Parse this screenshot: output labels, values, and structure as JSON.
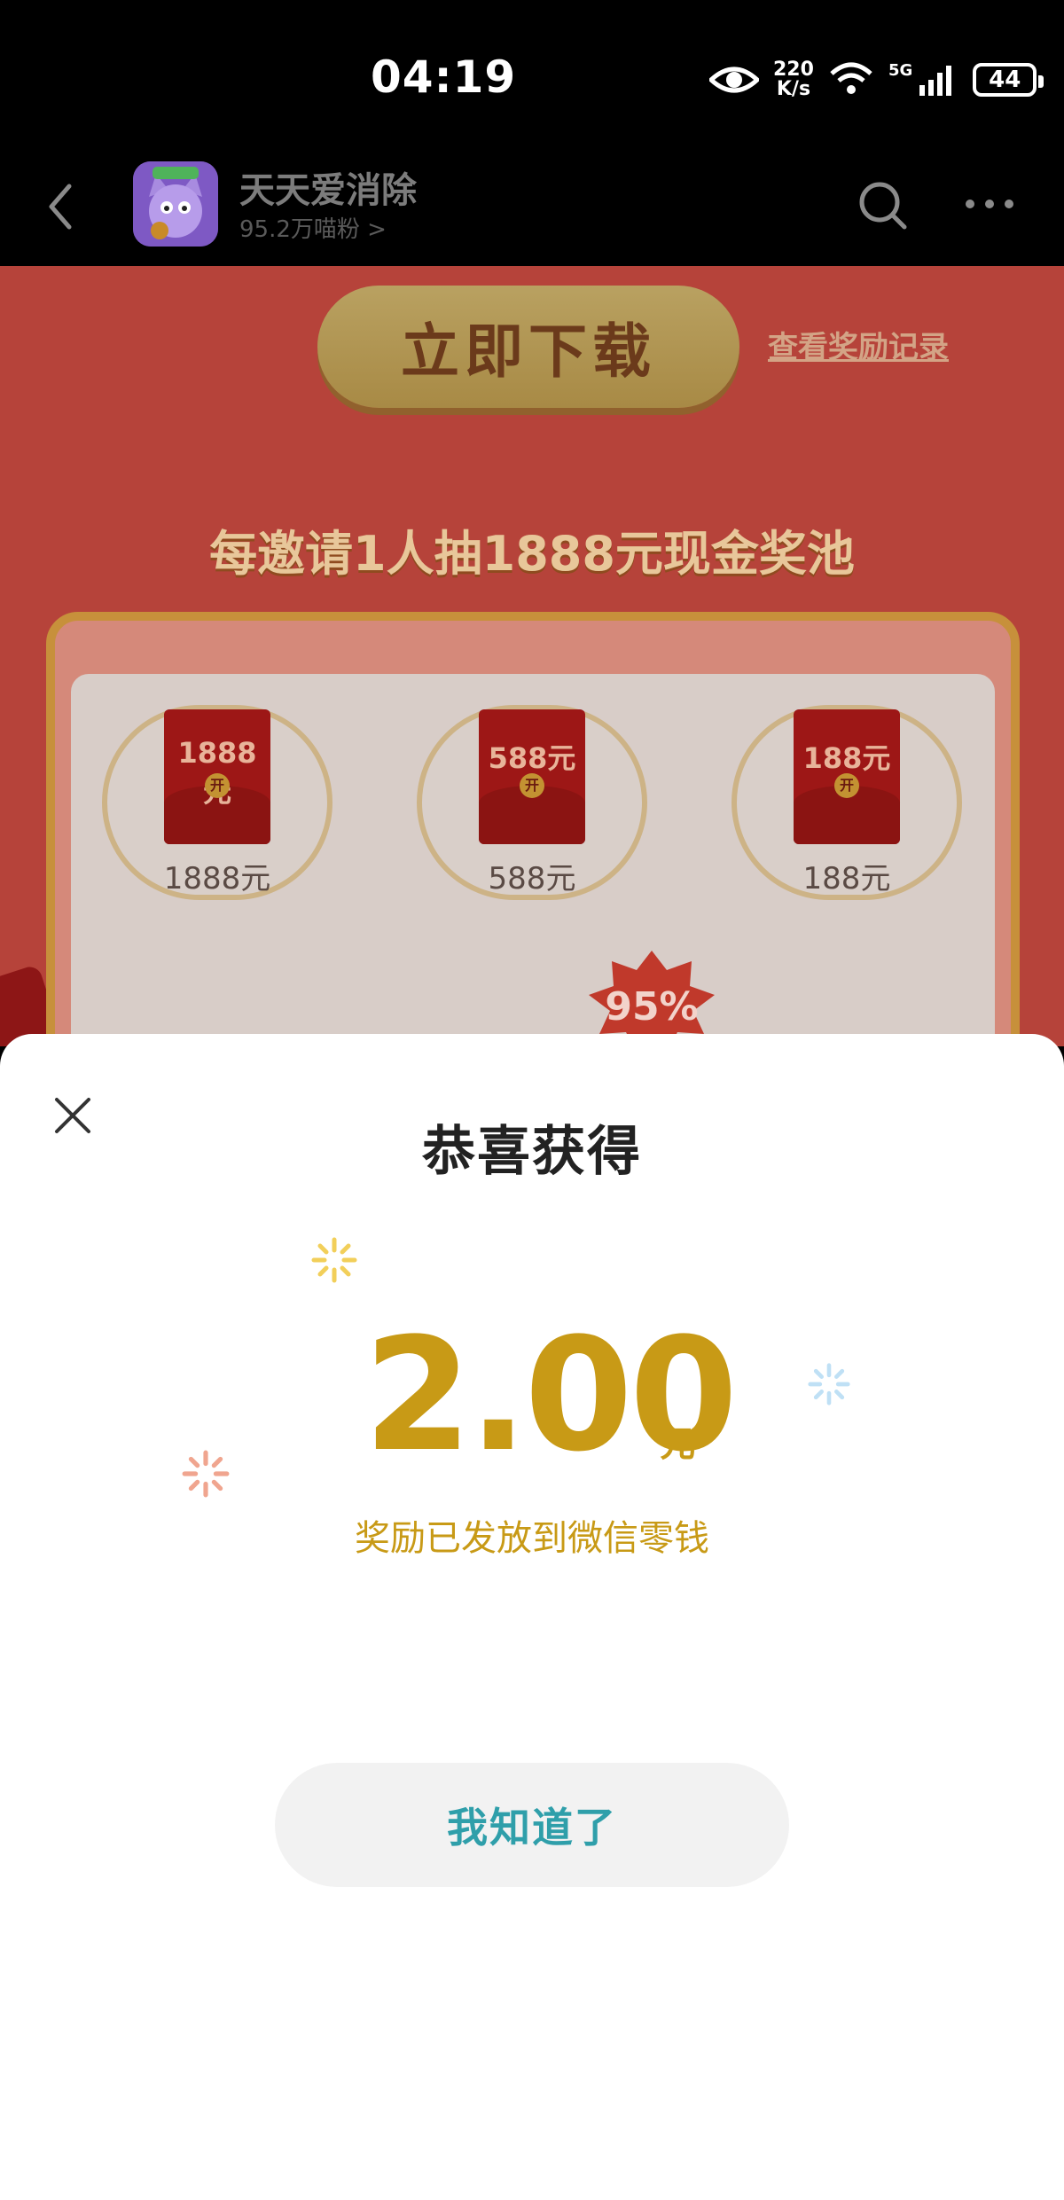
{
  "status_bar": {
    "time": "04:19",
    "net_speed_value": "220",
    "net_speed_unit": "K/s",
    "network_gen": "5G",
    "battery": "44"
  },
  "header": {
    "app_name": "天天爱消除",
    "followers": "95.2万喵粉 >"
  },
  "promo": {
    "download_button": "立即下载",
    "reward_record_link": "查看奖励记录",
    "headline": "每邀请1人抽1888元现金奖池",
    "prizes": [
      {
        "envelope_amount": "1888元",
        "open_label": "开",
        "label": "1888元"
      },
      {
        "envelope_amount": "588元",
        "open_label": "开",
        "label": "588元"
      },
      {
        "envelope_amount": "188元",
        "open_label": "开",
        "label": "188元"
      }
    ],
    "badge": "95%"
  },
  "modal": {
    "title": "恭喜获得",
    "amount": "2.00",
    "unit": "元",
    "note": "奖励已发放到微信零钱",
    "confirm_button": "我知道了"
  },
  "colors": {
    "accent_gold": "#c89a16",
    "button_text_teal": "#2f9faa",
    "promo_bg": "#b6433a"
  }
}
